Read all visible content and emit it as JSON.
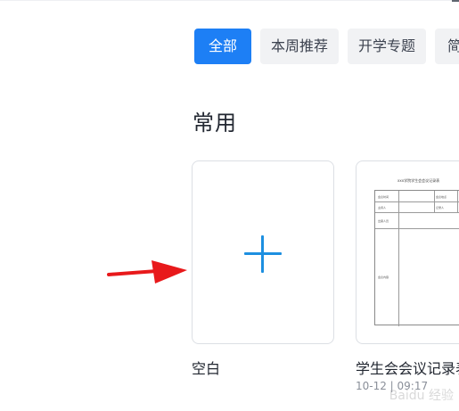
{
  "tabs": [
    {
      "label": "全部",
      "active": true
    },
    {
      "label": "本周推荐",
      "active": false
    },
    {
      "label": "开学专题",
      "active": false
    },
    {
      "label": "简",
      "active": false
    }
  ],
  "section": {
    "title": "常用"
  },
  "cards": [
    {
      "caption": "空白",
      "icon": "plus-icon"
    },
    {
      "caption": "学生会会议记录表",
      "meta": "10-12 | 09:17",
      "thumbnail": {
        "title": "xxx学院学生会会议记录表",
        "cells": [
          "会议时间",
          "会议地点",
          "主持人",
          "记录人",
          "出席人员",
          "会议内容"
        ]
      }
    }
  ],
  "annotation": {
    "arrow_color": "#e8191b"
  },
  "watermark": "Baidu 经验",
  "colors": {
    "accent": "#1d7ff5",
    "plus": "#1d8fe0",
    "tab_inactive_bg": "#f1f2f4"
  }
}
